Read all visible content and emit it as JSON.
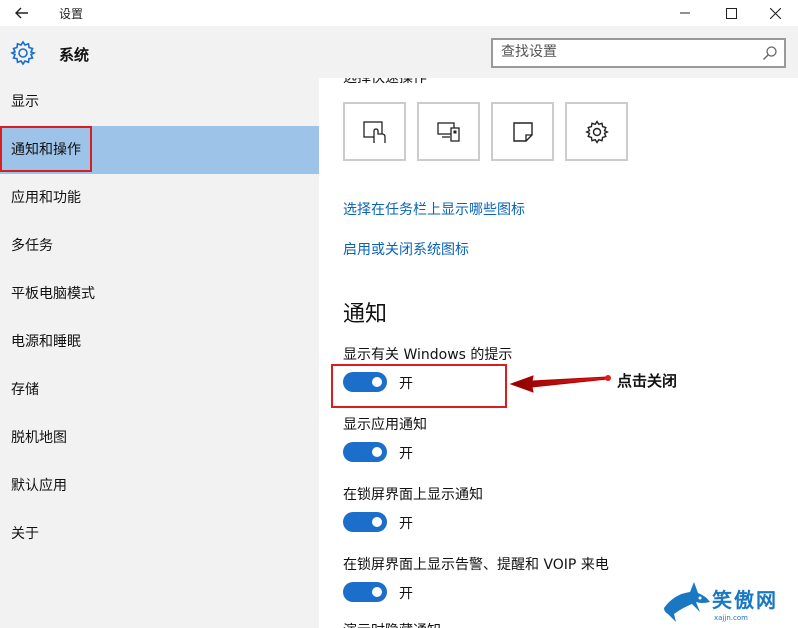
{
  "window": {
    "title": "设置",
    "back_icon": "arrow-left-icon",
    "minimize_icon": "minimize-icon",
    "maximize_icon": "maximize-icon",
    "close_icon": "close-icon"
  },
  "header": {
    "icon": "gear-icon",
    "title": "系统"
  },
  "search": {
    "placeholder": "查找设置",
    "icon": "search-icon"
  },
  "sidebar": {
    "items": [
      {
        "label": "显示",
        "active": false
      },
      {
        "label": "通知和操作",
        "active": true
      },
      {
        "label": "应用和功能",
        "active": false
      },
      {
        "label": "多任务",
        "active": false
      },
      {
        "label": "平板电脑模式",
        "active": false
      },
      {
        "label": "电源和睡眠",
        "active": false
      },
      {
        "label": "存储",
        "active": false
      },
      {
        "label": "脱机地图",
        "active": false
      },
      {
        "label": "默认应用",
        "active": false
      },
      {
        "label": "关于",
        "active": false
      }
    ]
  },
  "main": {
    "cut_heading": "选择快速操作",
    "quick_actions": [
      {
        "icon": "tablet-mode-icon"
      },
      {
        "icon": "connect-display-icon"
      },
      {
        "icon": "note-icon"
      },
      {
        "icon": "settings-gear-icon"
      }
    ],
    "links": [
      "选择在任务栏上显示哪些图标",
      "启用或关闭系统图标"
    ],
    "notifications_title": "通知",
    "settings": [
      {
        "label": "显示有关 Windows 的提示",
        "state": "开"
      },
      {
        "label": "显示应用通知",
        "state": "开"
      },
      {
        "label": "在锁屏界面上显示通知",
        "state": "开"
      },
      {
        "label": "在锁屏界面上显示告警、提醒和 VOIP 来电",
        "state": "开"
      }
    ],
    "cut_bottom": "演示时隐藏通知"
  },
  "annotation": {
    "text": "点击关闭"
  },
  "watermark": {
    "text": "笑傲网",
    "sub": "xajjn.com"
  },
  "colors": {
    "accent": "#1b6ec9",
    "link": "#0a63b8",
    "sidebar_bg": "#f2f2f2",
    "active_bg": "#9dc4e8",
    "annotation_red": "#d91e1e"
  }
}
